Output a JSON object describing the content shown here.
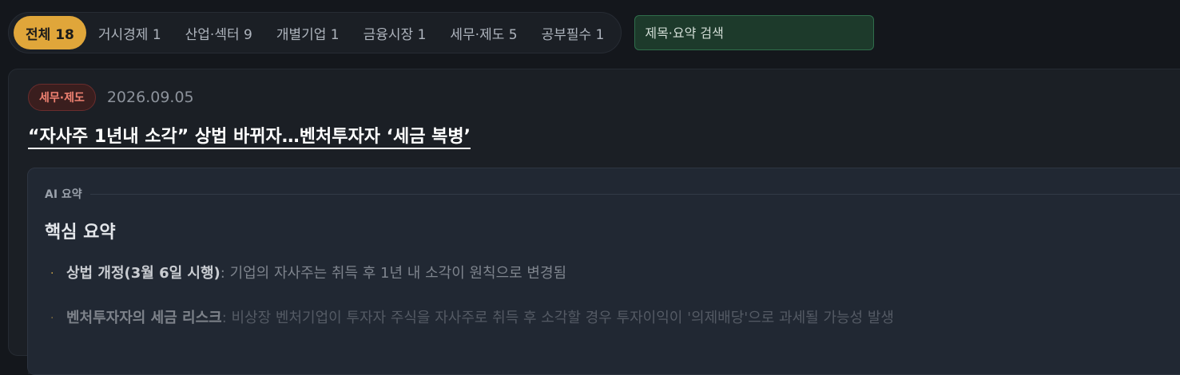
{
  "filters": {
    "tabs": [
      {
        "label": "전체 18",
        "active": true
      },
      {
        "label": "거시경제 1",
        "active": false
      },
      {
        "label": "산업·섹터 9",
        "active": false
      },
      {
        "label": "개별기업 1",
        "active": false
      },
      {
        "label": "금융시장 1",
        "active": false
      },
      {
        "label": "세무·제도 5",
        "active": false
      },
      {
        "label": "공부필수 1",
        "active": false
      }
    ],
    "search_placeholder": "제목·요약 검색"
  },
  "article": {
    "category": "세무·제도",
    "date": "2026.09.05",
    "headline": "“자사주 1년내 소각” 상법 바뀌자…벤처투자자 ‘세금 복병’",
    "summary": {
      "ai_label": "AI 요약",
      "title": "핵심 요약",
      "bullets": [
        {
          "bold": "상법 개정(3월 6일 시행)",
          "text": ": 기업의 자사주는 취득 후 1년 내 소각이 원칙으로 변경됨"
        },
        {
          "bold": "벤처투자자의 세금 리스크",
          "text": ": 비상장 벤처기업이 투자자 주식을 자사주로 취득 후 소각할 경우 투자이익이 '의제배당'으로 과세될 가능성 발생"
        }
      ]
    }
  },
  "colors": {
    "active_tab": "#e0a63a",
    "badge_text": "#f08272",
    "search_bg": "#1d3a2b"
  }
}
